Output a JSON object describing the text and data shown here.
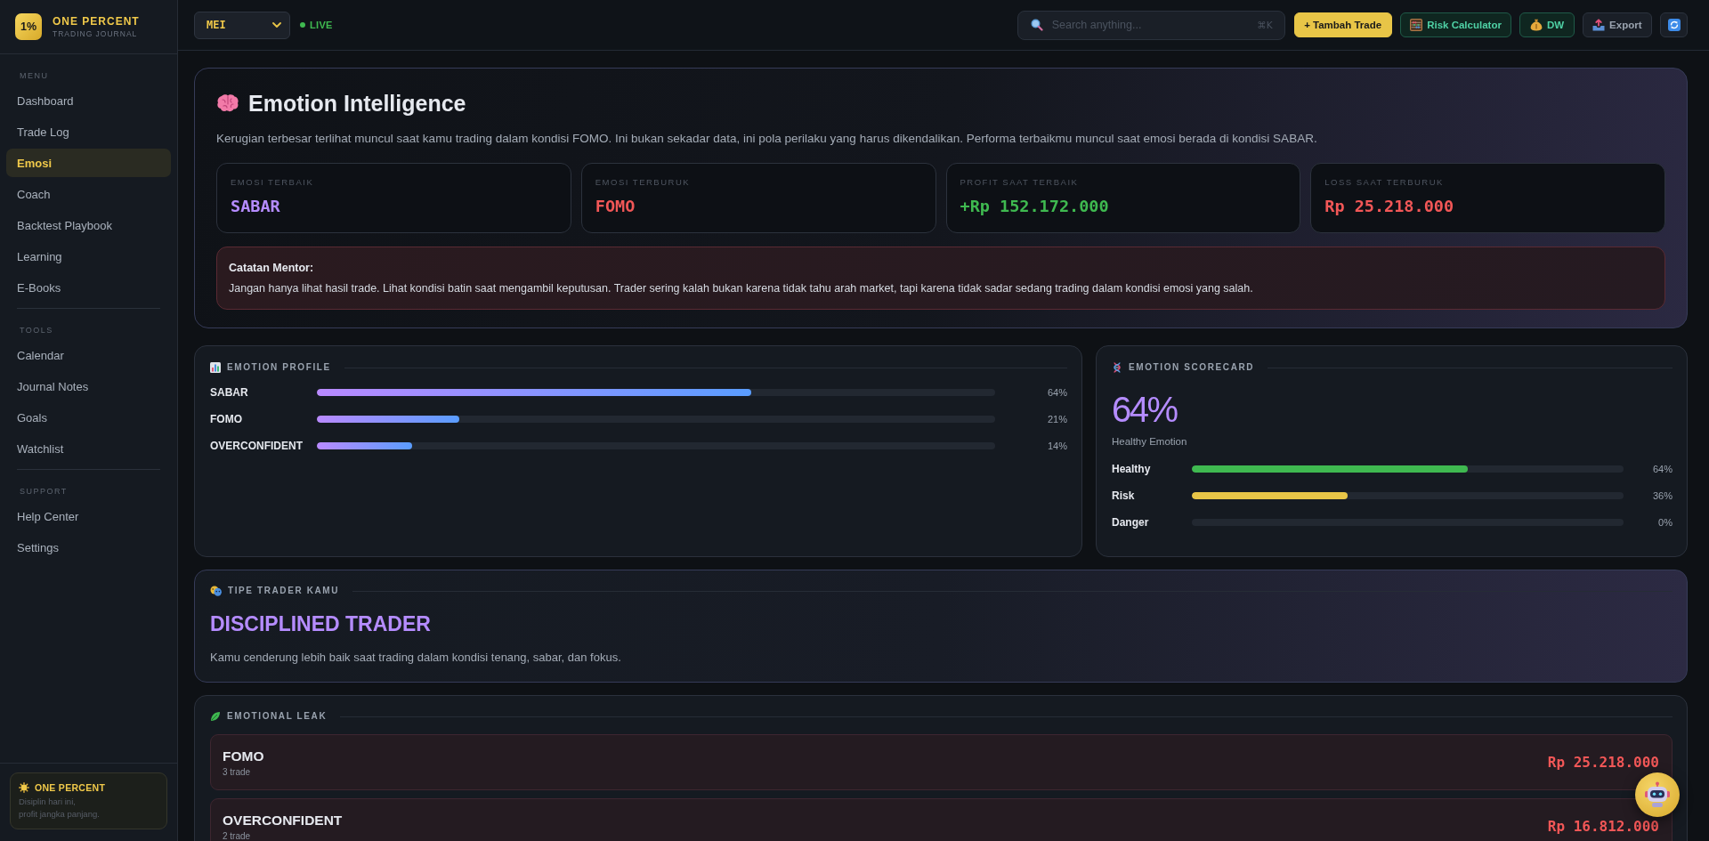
{
  "sidebar": {
    "brand": {
      "logo": "1%",
      "name": "ONE PERCENT",
      "tagline": "TRADING JOURNAL"
    },
    "sections": [
      {
        "title": "MENU",
        "items": [
          {
            "label": "Dashboard",
            "selected": false
          },
          {
            "label": "Trade Log",
            "selected": false
          },
          {
            "label": "Emosi",
            "selected": true
          },
          {
            "label": "Coach",
            "selected": false
          },
          {
            "label": "Backtest Playbook",
            "selected": false
          },
          {
            "label": "Learning",
            "selected": false
          },
          {
            "label": "E-Books",
            "selected": false
          }
        ]
      },
      {
        "title": "TOOLS",
        "items": [
          {
            "label": "Calendar",
            "selected": false
          },
          {
            "label": "Journal Notes",
            "selected": false
          },
          {
            "label": "Goals",
            "selected": false
          },
          {
            "label": "Watchlist",
            "selected": false
          }
        ]
      },
      {
        "title": "SUPPORT",
        "items": [
          {
            "label": "Help Center",
            "selected": false
          },
          {
            "label": "Settings",
            "selected": false
          }
        ]
      }
    ],
    "footer_card": {
      "title": "ONE PERCENT",
      "text": "Disiplin hari ini,\nprofit jangka panjang."
    }
  },
  "topbar": {
    "month_select": {
      "value": "MEI"
    },
    "live_label": "LIVE",
    "search": {
      "placeholder": "Search anything...",
      "shortcut": "⌘K"
    },
    "buttons": [
      {
        "kind": "primary",
        "label": "+ Tambah Trade"
      },
      {
        "kind": "calculator",
        "label": "Risk Calculator"
      },
      {
        "kind": "money",
        "label": "DW"
      },
      {
        "kind": "export",
        "label": "Export"
      },
      {
        "kind": "refresh"
      }
    ]
  },
  "hero": {
    "title": "Emotion Intelligence",
    "description": "Kerugian terbesar terlihat muncul saat kamu trading dalam kondisi FOMO. Ini bukan sekadar data, ini pola perilaku yang harus dikendalikan. Performa terbaikmu muncul saat emosi berada di kondisi SABAR.",
    "stats": [
      {
        "label": "EMOSI TERBAIK",
        "value": "SABAR",
        "color": "#b58cff"
      },
      {
        "label": "EMOSI TERBURUK",
        "value": "FOMO",
        "color": "#f25757"
      },
      {
        "label": "PROFIT SAAT TERBAIK",
        "value": "+Rp 152.172.000",
        "color": "#3fb950"
      },
      {
        "label": "LOSS SAAT TERBURUK",
        "value": "Rp 25.218.000",
        "color": "#f25757"
      }
    ],
    "mentor_note": {
      "title": "Catatan Mentor:",
      "text": "Jangan hanya lihat hasil trade. Lihat kondisi batin saat mengambil keputusan. Trader sering kalah bukan karena tidak tahu arah market, tapi karena tidak sadar sedang trading dalam kondisi emosi yang salah."
    }
  },
  "emotion_profile": {
    "title": "EMOTION PROFILE",
    "rows": [
      {
        "label": "SABAR",
        "level": 0.64,
        "reading": "64%"
      },
      {
        "label": "FOMO",
        "level": 0.21,
        "reading": "21%"
      },
      {
        "label": "OVERCONFIDENT",
        "level": 0.14,
        "reading": "14%"
      }
    ]
  },
  "emotion_scorecard": {
    "title": "EMOTION SCORECARD",
    "score": "64%",
    "caption": "Healthy Emotion",
    "rows": [
      {
        "label": "Healthy",
        "level": 0.64,
        "reading": "64%",
        "color": "#3fb950"
      },
      {
        "label": "Risk",
        "level": 0.36,
        "reading": "36%",
        "color": "#e8c547"
      },
      {
        "label": "Danger",
        "reading": "0%"
      }
    ]
  },
  "trader_type": {
    "title": "TIPE TRADER KAMU",
    "type": "DISCIPLINED TRADER",
    "description": "Kamu cenderung lebih baik saat trading dalam kondisi tenang, sabar, dan fokus."
  },
  "emotional_leak": {
    "title": "EMOTIONAL LEAK",
    "rows": [
      {
        "emotion": "FOMO",
        "trades": "3 trade",
        "amount": "Rp 25.218.000"
      },
      {
        "emotion": "OVERCONFIDENT",
        "trades": "2 trade",
        "amount": "Rp 16.812.000"
      }
    ]
  }
}
